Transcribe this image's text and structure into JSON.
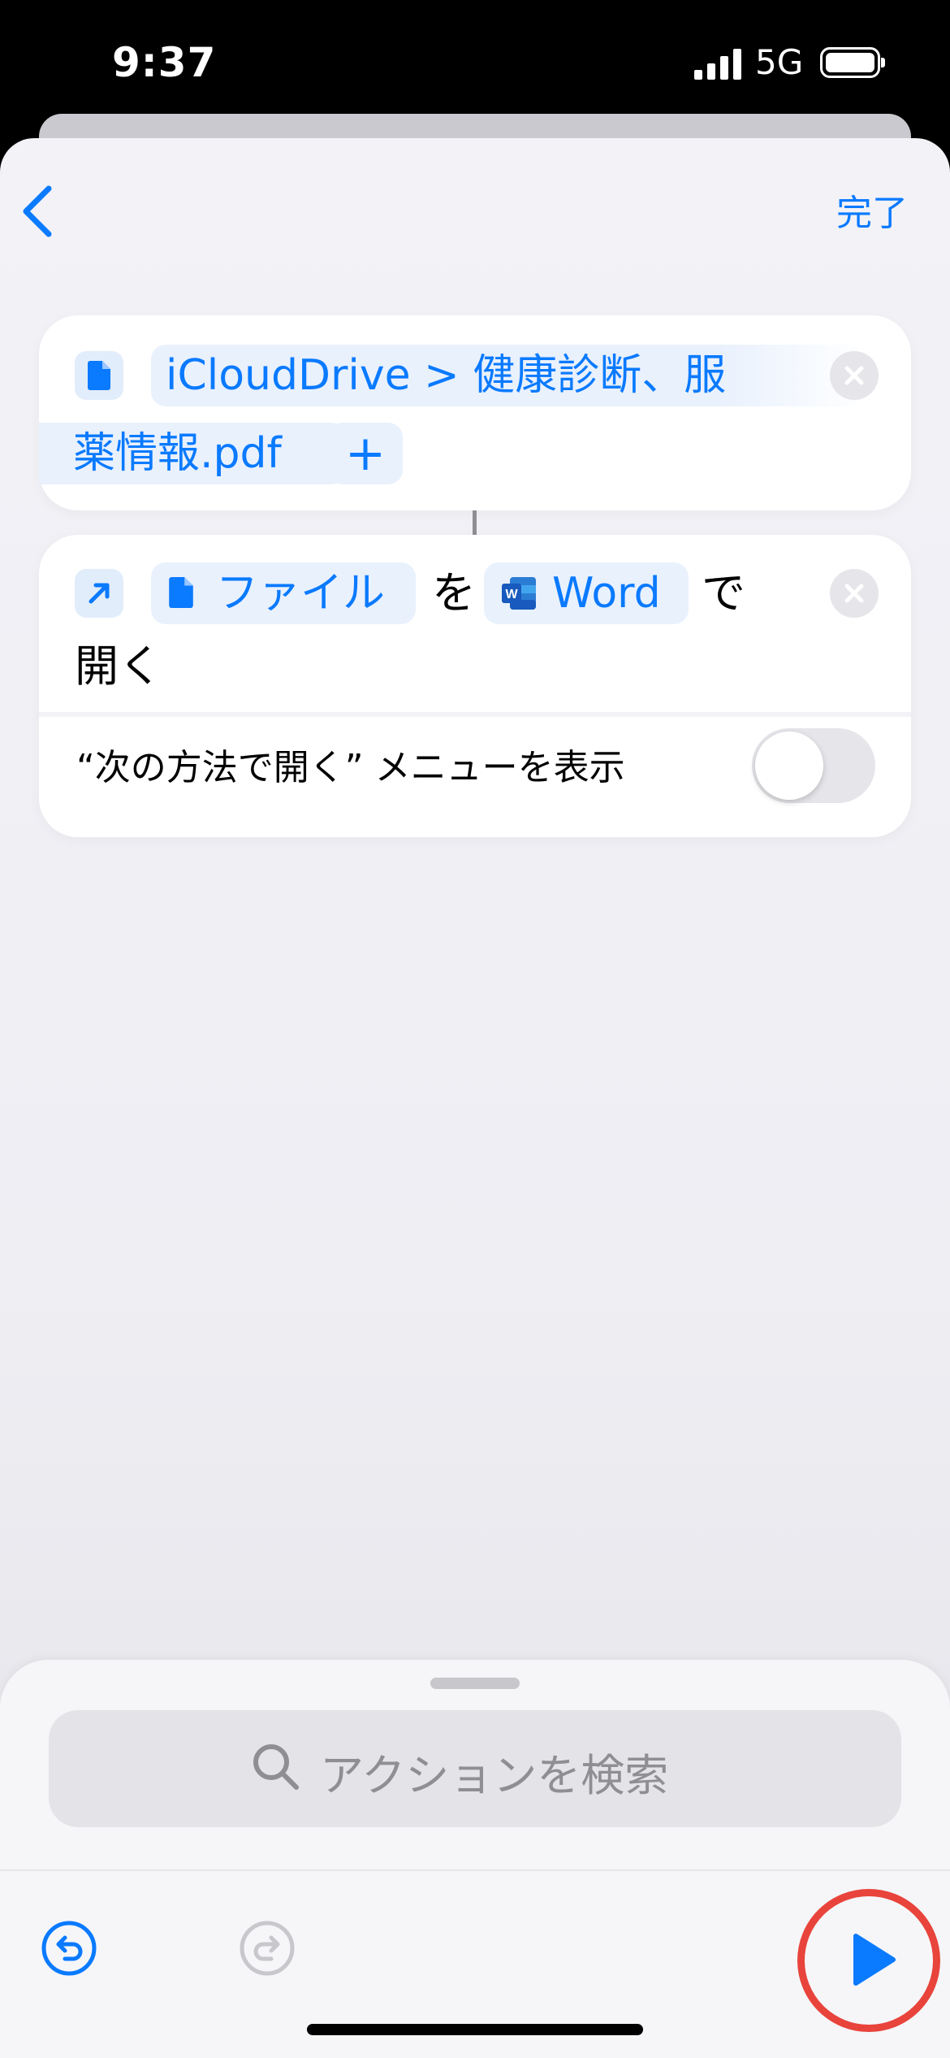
{
  "status_bar": {
    "time": "9:37",
    "network": "5G"
  },
  "nav": {
    "done_label": "完了"
  },
  "action1": {
    "path_line1": "iCloudDrive > 健康診断、服",
    "path_line2": "薬情報.pdf",
    "add_symbol": "+"
  },
  "action2": {
    "file_label": "ファイル",
    "particle_o": "を",
    "app_label": "Word",
    "particle_de": "で",
    "verb": "開く",
    "toggle_label": "“次の方法で開く” メニューを表示",
    "toggle_on": false
  },
  "bottom": {
    "search_placeholder": "アクションを検索"
  },
  "colors": {
    "accent": "#0a7aff",
    "highlight_ring": "#e8443c"
  }
}
